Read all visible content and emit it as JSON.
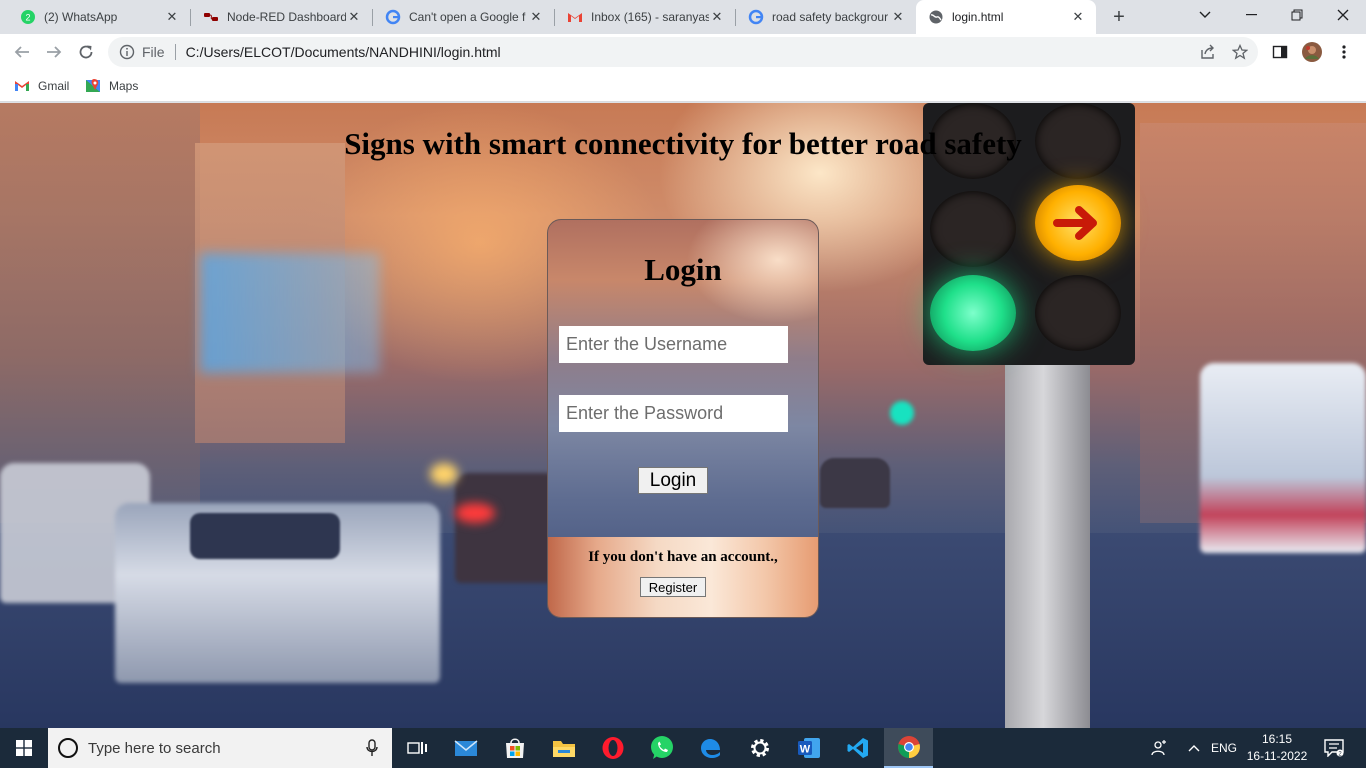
{
  "browser": {
    "tabs": [
      {
        "title": "(2) WhatsApp",
        "icon": "whatsapp-icon",
        "active": false
      },
      {
        "title": "Node-RED Dashboard",
        "icon": "node-red-icon",
        "active": false
      },
      {
        "title": "Can't open a Google f",
        "icon": "google-icon",
        "active": false
      },
      {
        "title": "Inbox (165) - saranyas",
        "icon": "gmail-icon",
        "active": false
      },
      {
        "title": "road safety backgrour",
        "icon": "google-icon",
        "active": false
      },
      {
        "title": "login.html",
        "icon": "globe-icon",
        "active": true
      }
    ],
    "omnibox": {
      "scheme_label": "File",
      "url": "C:/Users/ELCOT/Documents/NANDHINI/login.html"
    },
    "bookmarks": [
      {
        "label": "Gmail",
        "icon": "gmail-icon"
      },
      {
        "label": "Maps",
        "icon": "maps-icon"
      }
    ]
  },
  "page": {
    "heading": "Signs with smart connectivity for better road safety",
    "login_card": {
      "title": "Login",
      "username_placeholder": "Enter the Username",
      "password_placeholder": "Enter the Password",
      "login_button": "Login",
      "register_prompt": "If you don't have an account.,",
      "register_button": "Register"
    }
  },
  "taskbar": {
    "search_placeholder": "Type here to search",
    "apps": [
      "task-view",
      "mail",
      "store",
      "file-explorer",
      "opera",
      "whatsapp",
      "edge",
      "settings",
      "word",
      "vscode",
      "chrome"
    ],
    "language": "ENG",
    "time": "16:15",
    "date": "16-11-2022"
  },
  "colors": {
    "tab_strip": "#dee1e6",
    "taskbar": "#1b2a3a",
    "traffic_green": "#1fe08a",
    "traffic_amber": "#ffb000"
  }
}
